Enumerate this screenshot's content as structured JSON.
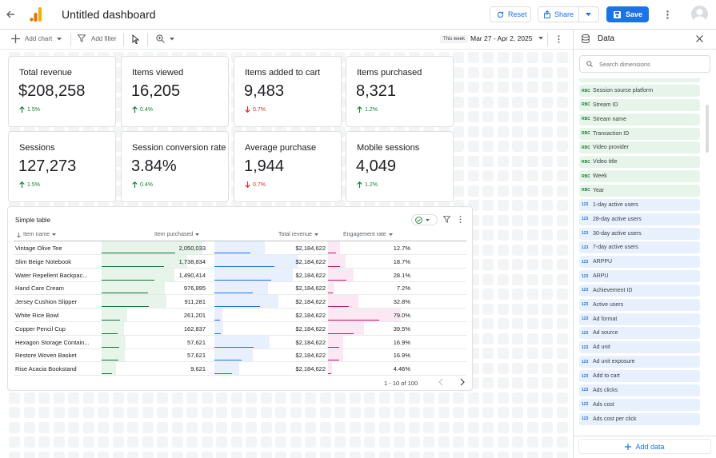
{
  "header": {
    "title": "Untitled dashboard",
    "reset_label": "Reset",
    "share_label": "Share",
    "save_label": "Save"
  },
  "toolbar": {
    "add_chart": "Add chart",
    "add_filter": "Add filter",
    "date_badge": "This week",
    "date_range": "Mar 27 - Apr 2, 2025"
  },
  "kpis": [
    {
      "label": "Total revenue",
      "value": "$208,258",
      "delta": "1.5%",
      "dir": "up"
    },
    {
      "label": "Items viewed",
      "value": "16,205",
      "delta": "0.4%",
      "dir": "up"
    },
    {
      "label": "Items added to cart",
      "value": "9,483",
      "delta": "0.7%",
      "dir": "down"
    },
    {
      "label": "Items purchased",
      "value": "8,321",
      "delta": "1.2%",
      "dir": "up"
    },
    {
      "label": "Sessions",
      "value": "127,273",
      "delta": "1.5%",
      "dir": "up"
    },
    {
      "label": "Session conversion rate",
      "value": "3.84%",
      "delta": "0.4%",
      "dir": "up"
    },
    {
      "label": "Average purchase",
      "value": "1,944",
      "delta": "0.7%",
      "dir": "down"
    },
    {
      "label": "Mobile sessions",
      "value": "4,049",
      "delta": "1.2%",
      "dir": "up"
    }
  ],
  "table": {
    "title": "Simple table",
    "columns": [
      "Item name",
      "Item purchased",
      "Total revenue",
      "Engagement rate"
    ],
    "rows": [
      {
        "name": "Vintage Olive Tee",
        "purchased": "2,050,033",
        "revenue": "$2,184,622",
        "engagement": "12.7%",
        "p": 1.0,
        "r": 0.45,
        "e": 0.127
      },
      {
        "name": "Slim Beige Notebook",
        "purchased": "1,738,834",
        "revenue": "$2,184,622",
        "engagement": "18.7%",
        "p": 0.85,
        "r": 0.74,
        "e": 0.187
      },
      {
        "name": "Water Repellent Backpac...",
        "purchased": "1,490,414",
        "revenue": "$2,184,622",
        "engagement": "28.1%",
        "p": 0.72,
        "r": 0.7,
        "e": 0.281
      },
      {
        "name": "Hand Care Cream",
        "purchased": "976,895",
        "revenue": "$2,184,622",
        "engagement": "7.2%",
        "p": 0.63,
        "r": 0.48,
        "e": 0.072
      },
      {
        "name": "Jersey Cushion Slipper",
        "purchased": "911,281",
        "revenue": "$2,184,622",
        "engagement": "32.8%",
        "p": 0.64,
        "r": 0.57,
        "e": 0.328
      },
      {
        "name": "White Rice Bowl",
        "purchased": "261,201",
        "revenue": "$2,184,622",
        "engagement": "79.0%",
        "p": 0.25,
        "r": 0.07,
        "e": 0.79
      },
      {
        "name": "Copper Pencil Cup",
        "purchased": "162,837",
        "revenue": "$2,184,622",
        "engagement": "39.5%",
        "p": 0.22,
        "r": 0.08,
        "e": 0.395
      },
      {
        "name": "Hexagon Storage Contain...",
        "purchased": "57,621",
        "revenue": "$2,184,622",
        "engagement": "16.9%",
        "p": 0.24,
        "r": 0.49,
        "e": 0.169
      },
      {
        "name": "Restore Woven Basket",
        "purchased": "57,621",
        "revenue": "$2,184,622",
        "engagement": "16.9%",
        "p": 0.23,
        "r": 0.34,
        "e": 0.169
      },
      {
        "name": "Rise Acacia Bookstand",
        "purchased": "9,621",
        "revenue": "$2,184,622",
        "engagement": "4.46%",
        "p": 0.14,
        "r": 0.22,
        "e": 0.0446
      }
    ],
    "pagination": "1 - 10 of 100"
  },
  "panel": {
    "title": "Data",
    "search_placeholder": "Search dimensions",
    "add_data": "Add data",
    "string_tag": "RBC",
    "number_tag": "123",
    "dimensions": [
      {
        "name": "Session source platform",
        "kind": "str"
      },
      {
        "name": "Stream ID",
        "kind": "str"
      },
      {
        "name": "Stream name",
        "kind": "str"
      },
      {
        "name": "Transaction ID",
        "kind": "str"
      },
      {
        "name": "Video provider",
        "kind": "str"
      },
      {
        "name": "Video title",
        "kind": "str"
      },
      {
        "name": "Week",
        "kind": "str"
      },
      {
        "name": "Year",
        "kind": "str"
      },
      {
        "name": "1-day active users",
        "kind": "num"
      },
      {
        "name": "28-day active users",
        "kind": "num"
      },
      {
        "name": "30-day active users",
        "kind": "num"
      },
      {
        "name": "7-day active users",
        "kind": "num"
      },
      {
        "name": "ARPPU",
        "kind": "num"
      },
      {
        "name": "ARPU",
        "kind": "num"
      },
      {
        "name": "Achievement ID",
        "kind": "num"
      },
      {
        "name": "Active users",
        "kind": "num"
      },
      {
        "name": "Ad format",
        "kind": "num"
      },
      {
        "name": "Ad source",
        "kind": "num"
      },
      {
        "name": "Ad unit",
        "kind": "num"
      },
      {
        "name": "Ad unit exposure",
        "kind": "num"
      },
      {
        "name": "Add to cart",
        "kind": "num"
      },
      {
        "name": "Ads clicks",
        "kind": "num"
      },
      {
        "name": "Ads cost",
        "kind": "num"
      },
      {
        "name": "Ads cost per click",
        "kind": "num"
      }
    ]
  },
  "colors": {
    "accent": "#1a73e8",
    "green_bar": "#e6f4ea",
    "green_line": "#137333",
    "blue_bar": "#e8f0fe",
    "blue_line": "#1a73e8",
    "pink_bar": "#fce8f3",
    "pink_line": "#c5126f",
    "up": "#188038",
    "down": "#d93025"
  }
}
